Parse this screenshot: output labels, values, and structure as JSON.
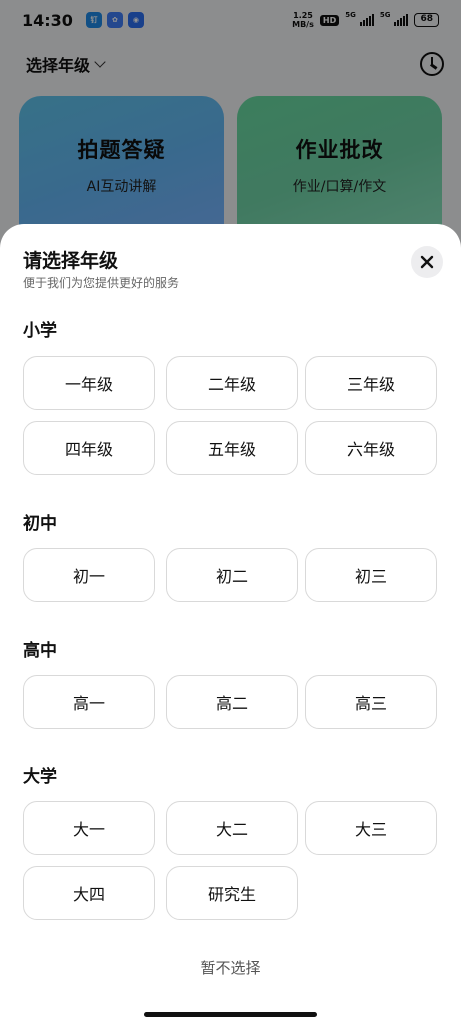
{
  "status_bar": {
    "time": "14:30",
    "apps": [
      {
        "name": "app-icon-1",
        "label": "钉",
        "color": "#1e88e5"
      },
      {
        "name": "app-icon-2",
        "label": "✿",
        "color": "#3f7cf5"
      },
      {
        "name": "app-icon-3",
        "label": "◉",
        "color": "#2b6ff0"
      }
    ],
    "speed_value": "1.25",
    "speed_unit": "MB/s",
    "hd": "HD",
    "net1": "5G",
    "net2": "5G",
    "battery": "68"
  },
  "header": {
    "grade_select_label": "选择年级"
  },
  "cards": {
    "left": {
      "title": "拍题答疑",
      "subtitle": "AI互动讲解"
    },
    "right": {
      "title": "作业批改",
      "subtitle": "作业/口算/作文"
    }
  },
  "sheet": {
    "title": "请选择年级",
    "subtitle": "便于我们为您提供更好的服务",
    "skip_label": "暂不选择",
    "sections": [
      {
        "title": "小学",
        "grades": [
          "一年级",
          "二年级",
          "三年级",
          "四年级",
          "五年级",
          "六年级"
        ]
      },
      {
        "title": "初中",
        "grades": [
          "初一",
          "初二",
          "初三"
        ]
      },
      {
        "title": "高中",
        "grades": [
          "高一",
          "高二",
          "高三"
        ]
      },
      {
        "title": "大学",
        "grades": [
          "大一",
          "大二",
          "大三",
          "大四",
          "研究生"
        ]
      }
    ]
  },
  "colors": {
    "card_left": "#5fc3ea",
    "card_right": "#67d9a0",
    "button_border": "#d9d9d9"
  }
}
